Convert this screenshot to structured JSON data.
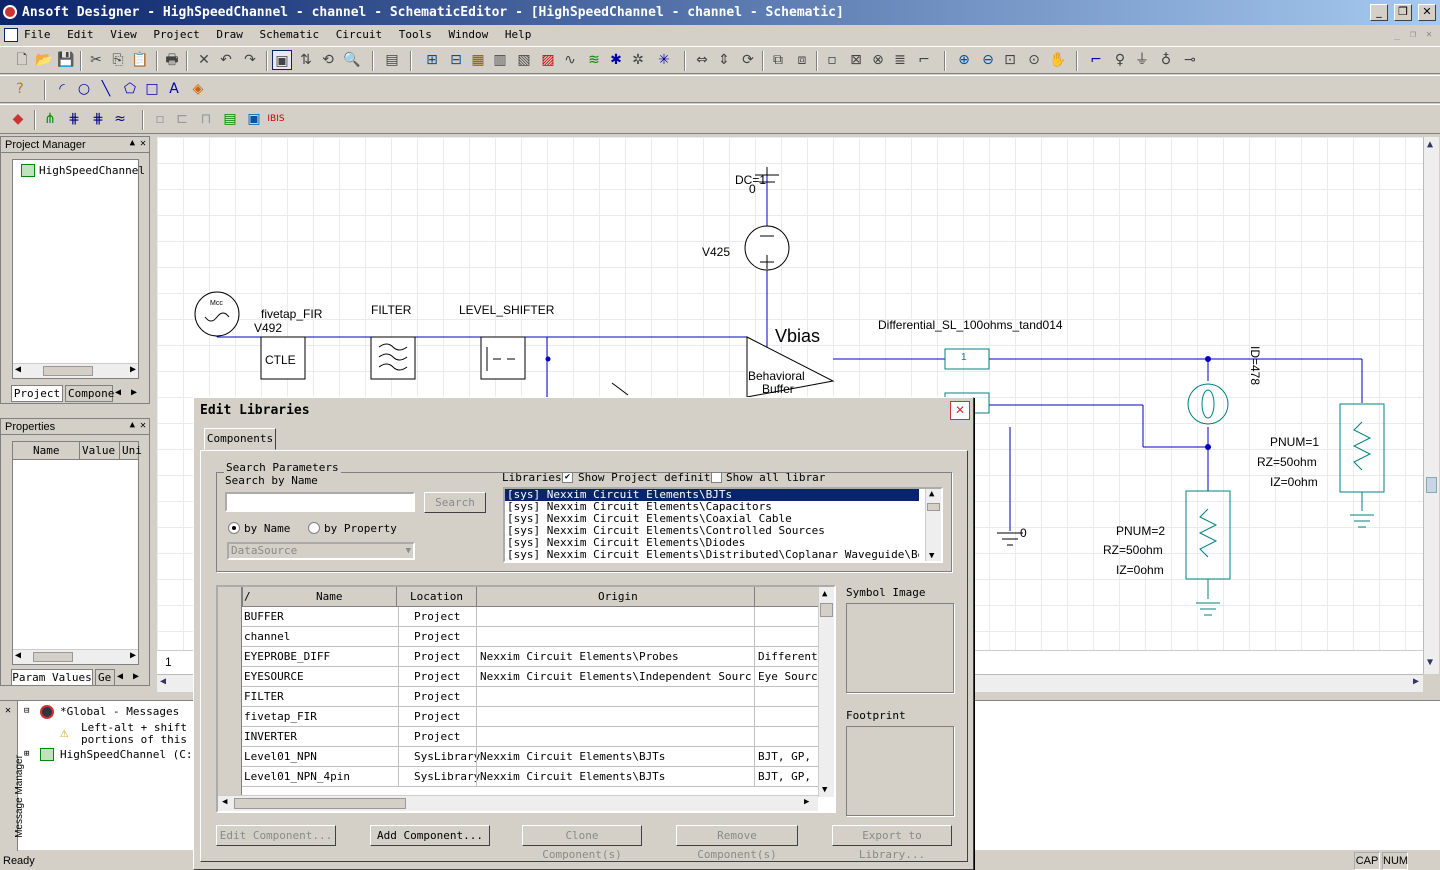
{
  "window": {
    "title": "Ansoft Designer - HighSpeedChannel - channel - SchematicEditor - [HighSpeedChannel - channel - Schematic]",
    "min": "_",
    "restore": "❐",
    "close": "✕"
  },
  "menu": [
    "File",
    "Edit",
    "View",
    "Project",
    "Draw",
    "Schematic",
    "Circuit",
    "Tools",
    "Window",
    "Help"
  ],
  "project_manager": {
    "title": "Project Manager",
    "tree_item": "HighSpeedChannel",
    "tabs": [
      "Project",
      "Compone"
    ]
  },
  "properties": {
    "title": "Properties",
    "columns": [
      "Name",
      "Value",
      "Uni"
    ],
    "tabs": [
      "Param Values",
      "Ge"
    ]
  },
  "schematic": {
    "labels": {
      "dc": "DC=1",
      "zero_top": "0",
      "v425": "V425",
      "fivetap": "fivetap_FIR",
      "v492": "V492",
      "ctle": "CTLE",
      "filter": "FILTER",
      "level_shifter": "LEVEL_SHIFTER",
      "vbias": "Vbias",
      "behavioral": "Behavioral",
      "buffer": "Buffer",
      "diff_sl": "Differential_SL_100ohms_tand014",
      "port1": "1",
      "id": "ID=478",
      "pnum1": "PNUM=1",
      "rz1": "RZ=50ohm",
      "iz1": "IZ=0ohm",
      "pnum2": "PNUM=2",
      "rz2": "RZ=50ohm",
      "iz2": "IZ=0ohm",
      "gnd0": "0",
      "page": "1",
      "mcc": "Mcc"
    }
  },
  "messages": {
    "root": "*Global - Messages",
    "warning": "Left-alt + shift is",
    "warning2": "portions of this ap",
    "project": "HighSpeedChannel (C:/P",
    "vertical_tab": "Message Manager"
  },
  "status": {
    "left": "Ready",
    "cap": "CAP",
    "num": "NUM"
  },
  "dialog": {
    "title": "Edit Libraries",
    "tab": "Components",
    "search": {
      "group": "Search Parameters",
      "by_name_label": "Search by Name",
      "button": "Search",
      "radio_name": "by Name",
      "radio_property": "by Property",
      "datasource": "DataSource"
    },
    "libraries": {
      "label": "Libraries",
      "show_project": "Show Project definitio",
      "show_all": "Show all librari",
      "items": [
        "[sys] Nexxim Circuit Elements\\BJTs",
        "[sys] Nexxim Circuit Elements\\Capacitors",
        "[sys] Nexxim Circuit Elements\\Coaxial Cable",
        "[sys] Nexxim Circuit Elements\\Controlled Sources",
        "[sys] Nexxim Circuit Elements\\Diodes",
        "[sys] Nexxim Circuit Elements\\Distributed\\Coplanar Waveguide\\Bends"
      ]
    },
    "grid": {
      "columns": [
        "/",
        "Name",
        "Location",
        "Origin",
        ""
      ],
      "rows": [
        [
          "BUFFER",
          "Project",
          "",
          ""
        ],
        [
          "channel",
          "Project",
          "",
          ""
        ],
        [
          "EYEPROBE_DIFF",
          "Project",
          "Nexxim Circuit Elements\\Probes",
          "Differenti"
        ],
        [
          "EYESOURCE",
          "Project",
          "Nexxim Circuit Elements\\Independent Sources",
          "Eye Source"
        ],
        [
          "FILTER",
          "Project",
          "",
          ""
        ],
        [
          "fivetap_FIR",
          "Project",
          "",
          ""
        ],
        [
          "INVERTER",
          "Project",
          "",
          ""
        ],
        [
          "Level01_NPN",
          "SysLibrary",
          "Nexxim Circuit Elements\\BJTs",
          "BJT, GP, NP"
        ],
        [
          "Level01_NPN_4pin",
          "SysLibrary",
          "Nexxim Circuit Elements\\BJTs",
          "BJT, GP, NP"
        ]
      ]
    },
    "symbol_image": "Symbol Image",
    "footprint": "Footprint",
    "buttons": {
      "edit": "Edit Component...",
      "add": "Add Component...",
      "clone": "Clone Component(s)",
      "remove": "Remove Component(s)",
      "export": "Export to Library..."
    }
  },
  "colors": {
    "accent": "#0a246a",
    "wire": "#0000c0",
    "teal": "#008080"
  }
}
